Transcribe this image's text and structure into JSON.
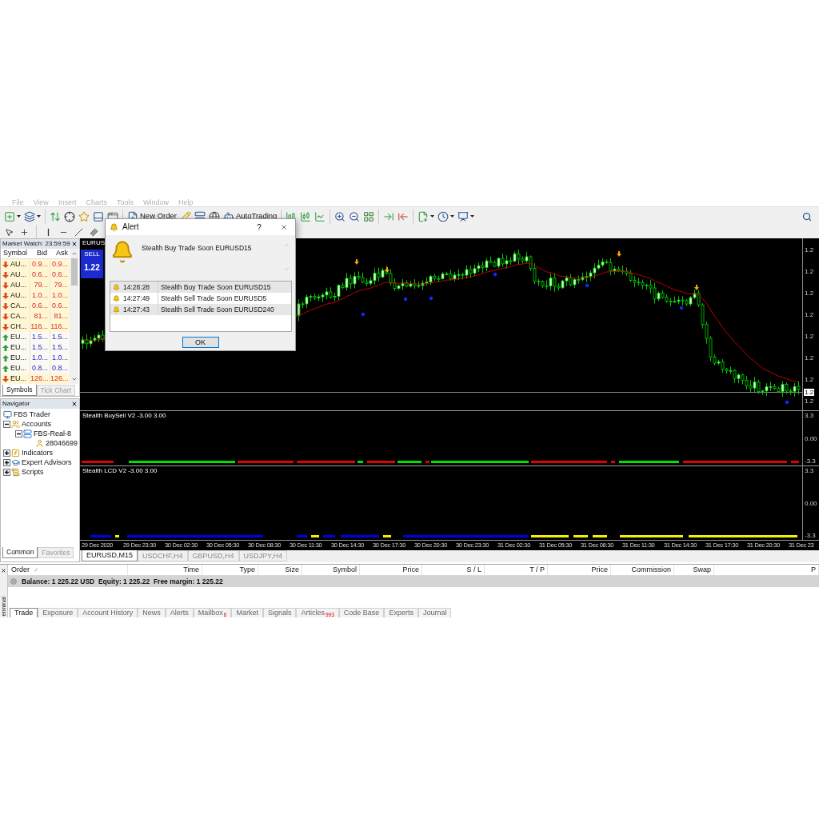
{
  "menu": {
    "items": [
      "File",
      "View",
      "Insert",
      "Charts",
      "Tools",
      "Window",
      "Help"
    ]
  },
  "toolbar": {
    "new_order": "New Order",
    "autotrading": "AutoTrading"
  },
  "market_watch": {
    "title": "Market Watch: 23:59:59",
    "columns": [
      "Symbol",
      "Bid",
      "Ask"
    ],
    "rows": [
      {
        "symbol": "AU...",
        "bid": "0.9...",
        "ask": "0.9...",
        "rising": false
      },
      {
        "symbol": "AU...",
        "bid": "0.6...",
        "ask": "0.6...",
        "rising": false
      },
      {
        "symbol": "AU...",
        "bid": "79...",
        "ask": "79...",
        "rising": false
      },
      {
        "symbol": "AU...",
        "bid": "1.0...",
        "ask": "1.0...",
        "rising": false
      },
      {
        "symbol": "CA...",
        "bid": "0.6...",
        "ask": "0.6...",
        "rising": false
      },
      {
        "symbol": "CA...",
        "bid": "81...",
        "ask": "81...",
        "rising": false
      },
      {
        "symbol": "CH...",
        "bid": "116...",
        "ask": "116...",
        "rising": false
      },
      {
        "symbol": "EU...",
        "bid": "1.5...",
        "ask": "1.5...",
        "rising": true
      },
      {
        "symbol": "EU...",
        "bid": "1.5...",
        "ask": "1.5...",
        "rising": true
      },
      {
        "symbol": "EU...",
        "bid": "1.0...",
        "ask": "1.0...",
        "rising": true
      },
      {
        "symbol": "EU...",
        "bid": "0.8...",
        "ask": "0.8...",
        "rising": true
      },
      {
        "symbol": "EU...",
        "bid": "126...",
        "ask": "126...",
        "rising": false
      }
    ],
    "tabs": [
      {
        "label": "Symbols",
        "selected": true
      },
      {
        "label": "Tick Chart",
        "selected": false
      }
    ]
  },
  "navigator": {
    "title": "Navigator",
    "tree": [
      {
        "label": "FBS Trader",
        "kind": "terminal",
        "children": [
          {
            "label": "Accounts",
            "kind": "accounts",
            "expanded": true,
            "children": [
              {
                "label": "FBS-Real-8",
                "kind": "server",
                "expanded": true,
                "children": [
                  {
                    "label": "28046699",
                    "kind": "account"
                  }
                ]
              }
            ]
          },
          {
            "label": "Indicators",
            "kind": "indicators",
            "expanded": false
          },
          {
            "label": "Expert Advisors",
            "kind": "experts",
            "expanded": false
          },
          {
            "label": "Scripts",
            "kind": "scripts",
            "expanded": false
          }
        ]
      }
    ],
    "tabs": [
      {
        "label": "Common",
        "selected": true
      },
      {
        "label": "Favorites",
        "selected": false
      }
    ]
  },
  "chart": {
    "symbol": "EURUS",
    "one_click": {
      "label": "SELL",
      "price": "1.22"
    },
    "price_axis": {
      "labels": [
        "1.2",
        "1.2",
        "1.2",
        "1.2",
        "1.2",
        "1.2",
        "1.2",
        "1.2"
      ],
      "current": "1.2"
    },
    "subwindows": [
      {
        "title": "Stealth BuySell V2 -3.00 3.00",
        "axis": [
          "3.3",
          "0.00",
          "-3.3"
        ]
      },
      {
        "title": "Stealth LCD V2 -3.00 3.00",
        "axis": [
          "3.3",
          "0.00",
          "-3.3"
        ]
      }
    ],
    "time_axis": [
      "29 Dec 2020",
      "29 Dec 23:30",
      "30 Dec 02:30",
      "30 Dec 05:30",
      "30 Dec 08:30",
      "30 Dec 11:30",
      "30 Dec 14:30",
      "30 Dec 17:30",
      "30 Dec 20:30",
      "30 Dec 23:30",
      "31 Dec 02:30",
      "31 Dec 05:30",
      "31 Dec 08:30",
      "31 Dec 11:30",
      "31 Dec 14:30",
      "31 Dec 17:30",
      "31 Dec 20:30",
      "31 Dec 23"
    ],
    "tabs": [
      {
        "label": "EURUSD,M15",
        "selected": true
      },
      {
        "label": "USDCHF,H4",
        "selected": false
      },
      {
        "label": "GBPUSD,H4",
        "selected": false
      },
      {
        "label": "USDJPY,H4",
        "selected": false
      }
    ]
  },
  "alert_dialog": {
    "title": "Alert",
    "help": "?",
    "message": "Stealth Buy Trade Soon EURUSD15",
    "rows": [
      {
        "time": "14:28:28",
        "text": "Stealth Buy Trade Soon EURUSD15"
      },
      {
        "time": "14:27:49",
        "text": "Stealth Sell Trade Soon EURUSD5"
      },
      {
        "time": "14:27:43",
        "text": "Stealth Sell Trade Soon EURUSD240"
      }
    ],
    "ok": "OK"
  },
  "terminal": {
    "side_label": "erminal",
    "columns": [
      "Order",
      "Time",
      "Type",
      "Size",
      "Symbol",
      "Price",
      "S / L",
      "T / P",
      "Price",
      "Commission",
      "Swap",
      "P"
    ],
    "balance": "Balance: 1 225.22 USD  Equity: 1 225.22  Free margin: 1 225.22",
    "tabs": [
      {
        "label": "Trade",
        "selected": true
      },
      {
        "label": "Exposure",
        "selected": false
      },
      {
        "label": "Account History",
        "selected": false
      },
      {
        "label": "News",
        "selected": false
      },
      {
        "label": "Alerts",
        "selected": false
      },
      {
        "label": "Mailbox",
        "badge": "6",
        "selected": false
      },
      {
        "label": "Market",
        "selected": false
      },
      {
        "label": "Signals",
        "selected": false
      },
      {
        "label": "Articles",
        "badge": "993",
        "selected": false
      },
      {
        "label": "Code Base",
        "selected": false
      },
      {
        "label": "Experts",
        "selected": false
      },
      {
        "label": "Journal",
        "selected": false
      }
    ]
  }
}
